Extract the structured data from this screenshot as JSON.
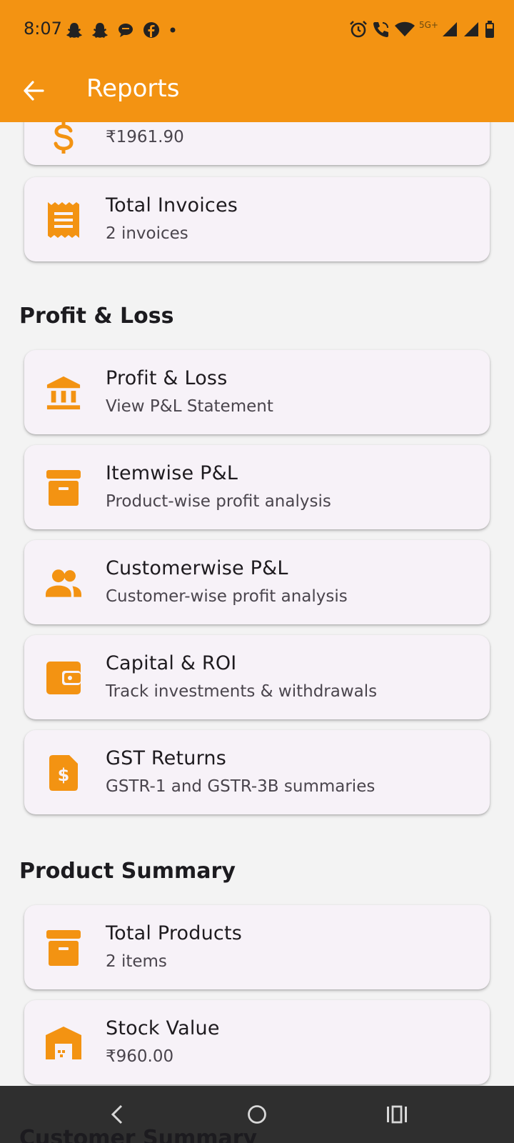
{
  "status_bar": {
    "time": "8:07",
    "network": "5G+"
  },
  "app_bar": {
    "title": "Reports"
  },
  "sections": {
    "sales_partial": [
      {
        "value": "₹1961.90",
        "icon": "dollar-icon"
      },
      {
        "label": "Total Invoices",
        "value": "2 invoices",
        "icon": "receipt-icon"
      }
    ],
    "profit_loss": {
      "title": "Profit & Loss",
      "items": [
        {
          "label": "Profit & Loss",
          "subtitle": "View P&L Statement",
          "icon": "bank-icon"
        },
        {
          "label": "Itemwise P&L",
          "subtitle": "Product-wise profit analysis",
          "icon": "archive-icon"
        },
        {
          "label": "Customerwise P&L",
          "subtitle": "Customer-wise profit analysis",
          "icon": "people-icon"
        },
        {
          "label": "Capital & ROI",
          "subtitle": "Track investments & withdrawals",
          "icon": "wallet-icon"
        },
        {
          "label": "GST Returns",
          "subtitle": "GSTR-1 and GSTR-3B summaries",
          "icon": "tax-document-icon"
        }
      ]
    },
    "product_summary": {
      "title": "Product Summary",
      "items": [
        {
          "label": "Total Products",
          "value": "2 items",
          "icon": "archive-icon"
        },
        {
          "label": "Stock Value",
          "value": "₹960.00",
          "icon": "warehouse-icon"
        }
      ]
    },
    "customer_summary": {
      "title": "Customer Summary"
    }
  },
  "colors": {
    "accent": "#F39312",
    "card_bg": "#F7F2F8",
    "page_bg": "#F3F3F3",
    "nav_bg": "#2F2F2F"
  }
}
